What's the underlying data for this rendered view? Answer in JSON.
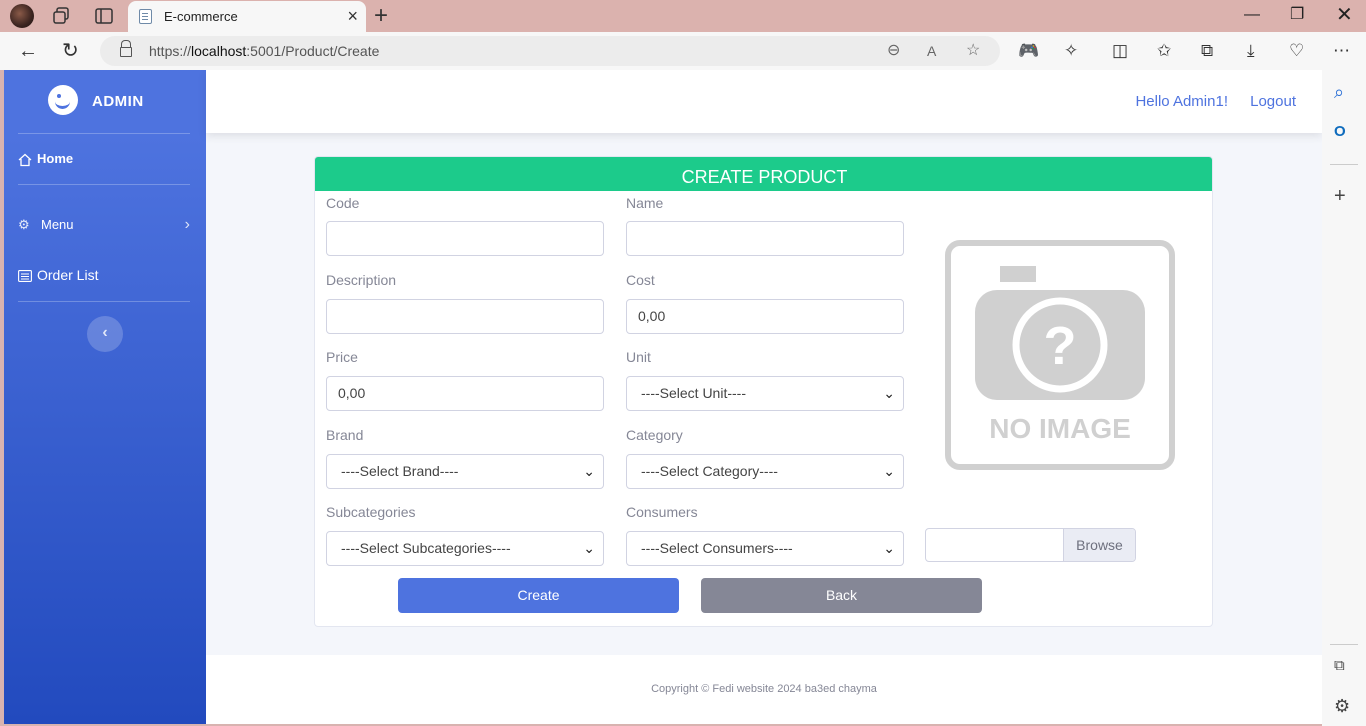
{
  "browser": {
    "tab_title": "E-commerce",
    "url_prefix": "https://",
    "url_host": "localhost",
    "url_rest": ":5001/Product/Create"
  },
  "sidebar": {
    "brand": "ADMIN",
    "items": [
      {
        "label": "Home",
        "icon": "home-icon"
      },
      {
        "label": "Menu",
        "icon": "gear-icon"
      },
      {
        "label": "Order List",
        "icon": "list-icon"
      }
    ]
  },
  "topbar": {
    "greeting": "Hello Admin1!",
    "logout": "Logout"
  },
  "form": {
    "title": "CREATE PRODUCT",
    "code_label": "Code",
    "name_label": "Name",
    "description_label": "Description",
    "cost_label": "Cost",
    "cost_value": "0,00",
    "price_label": "Price",
    "price_value": "0,00",
    "unit_label": "Unit",
    "unit_selected": "----Select Unit----",
    "brand_label": "Brand",
    "brand_selected": "----Select Brand----",
    "category_label": "Category",
    "category_selected": "----Select Category----",
    "subcategories_label": "Subcategories",
    "subcategories_selected": "----Select Subcategories----",
    "consumers_label": "Consumers",
    "consumers_selected": "----Select Consumers----",
    "no_image_text": "NO IMAGE",
    "browse_label": "Browse",
    "create_label": "Create",
    "back_label": "Back"
  },
  "footer": {
    "copyright": "Copyright © Fedi website 2024 ba3ed chayma"
  },
  "colors": {
    "sidebar_top": "#4e73df",
    "sidebar_bottom": "#224abe",
    "card_header": "#1ccb8b",
    "primary": "#4e73df",
    "secondary": "#858796"
  }
}
